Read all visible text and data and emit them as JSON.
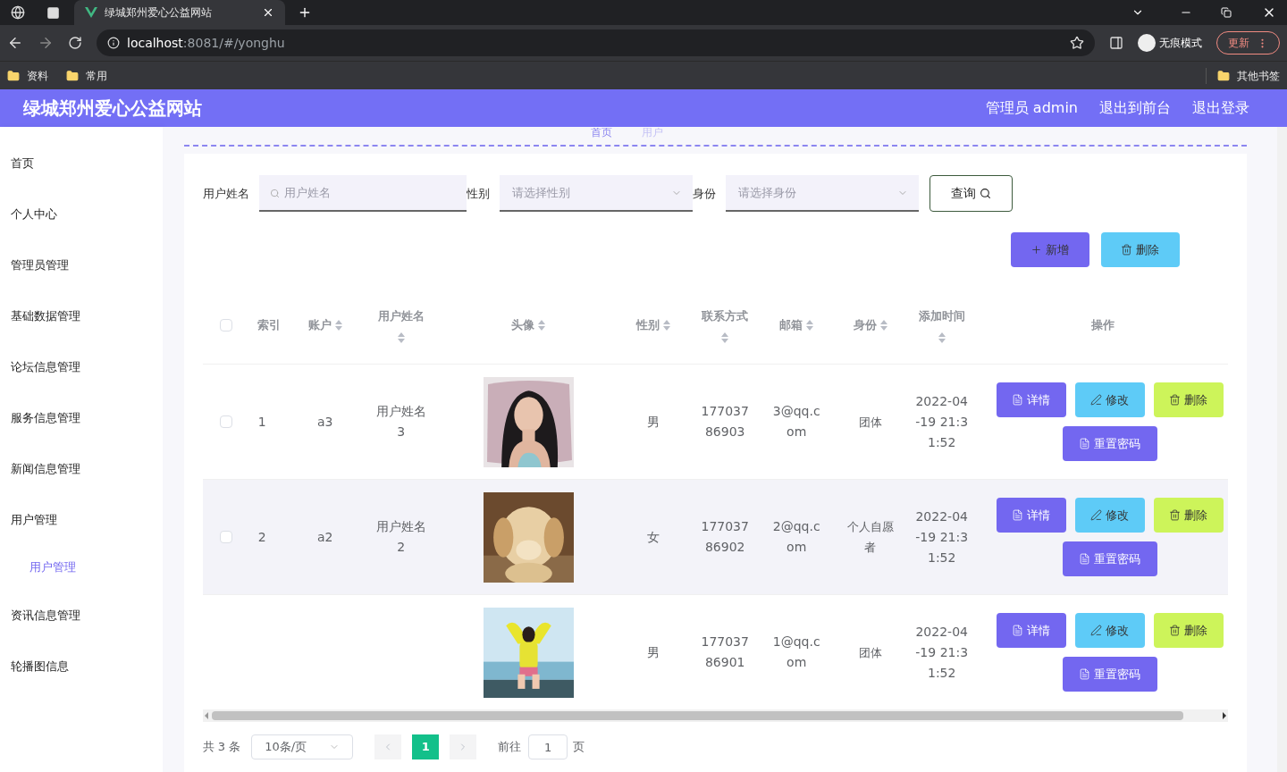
{
  "browser": {
    "tab_title": "绿城郑州爱心公益网站",
    "url_host": "localhost",
    "url_rest": ":8081/#/yonghu",
    "incognito_label": "无痕模式",
    "update_label": "更新",
    "bookmarks": [
      "资料",
      "常用"
    ],
    "other_bookmarks": "其他书签"
  },
  "header": {
    "title": "绿城郑州爱心公益网站",
    "links": [
      "管理员 admin",
      "退出到前台",
      "退出登录"
    ]
  },
  "sidebar": {
    "items": [
      {
        "label": "首页",
        "selected": false
      },
      {
        "label": "个人中心",
        "selected": false
      },
      {
        "label": "管理员管理",
        "selected": false
      },
      {
        "label": "基础数据管理",
        "selected": false
      },
      {
        "label": "论坛信息管理",
        "selected": false
      },
      {
        "label": "服务信息管理",
        "selected": false
      },
      {
        "label": "新闻信息管理",
        "selected": false
      },
      {
        "label": "用户管理",
        "selected": false,
        "children": [
          {
            "label": "用户管理",
            "selected": true
          }
        ]
      },
      {
        "label": "资讯信息管理",
        "selected": false
      },
      {
        "label": "轮播图信息",
        "selected": false
      }
    ]
  },
  "breadcrumb": [
    "首页",
    "用户"
  ],
  "search": {
    "fields": [
      {
        "kind": "text",
        "label": "用户姓名",
        "placeholder": "用户姓名"
      },
      {
        "kind": "select",
        "label": "性别",
        "placeholder": "请选择性别"
      },
      {
        "kind": "select",
        "label": "身份",
        "placeholder": "请选择身份"
      }
    ],
    "query_button": "查询"
  },
  "toolbar": [
    {
      "kind": "add",
      "label": "新增"
    },
    {
      "kind": "delete",
      "label": "删除"
    }
  ],
  "table": {
    "columns": [
      {
        "label": "索引",
        "sortable": false
      },
      {
        "label": "账户",
        "sortable": true
      },
      {
        "label": "用户姓名",
        "sortable": true
      },
      {
        "label": "头像",
        "sortable": true
      },
      {
        "label": "性别",
        "sortable": true
      },
      {
        "label": "联系方式",
        "sortable": true
      },
      {
        "label": "邮箱",
        "sortable": true
      },
      {
        "label": "身份",
        "sortable": true
      },
      {
        "label": "添加时间",
        "sortable": true
      },
      {
        "label": "操作",
        "sortable": false
      }
    ],
    "header_checked": false,
    "rows": [
      {
        "checked": false,
        "hovered": false,
        "index": "1",
        "account": "a3",
        "name": "用户姓名3",
        "gender": "男",
        "phone": "17703786903",
        "email": "3@qq.com",
        "role": "团体",
        "time": "2022-04-19 21:31:52",
        "actions": [
          {
            "kind": "detail",
            "label": "详情"
          },
          {
            "kind": "edit",
            "label": "修改"
          },
          {
            "kind": "delete",
            "label": "删除"
          },
          {
            "kind": "reset",
            "label": "重置密码"
          }
        ]
      },
      {
        "checked": false,
        "hovered": true,
        "index": "2",
        "account": "a2",
        "name": "用户姓名2",
        "gender": "女",
        "phone": "17703786902",
        "email": "2@qq.com",
        "role": "个人自愿者",
        "time": "2022-04-19 21:31:52",
        "actions": [
          {
            "kind": "detail",
            "label": "详情"
          },
          {
            "kind": "edit",
            "label": "修改"
          },
          {
            "kind": "delete",
            "label": "删除"
          },
          {
            "kind": "reset",
            "label": "重置密码"
          }
        ]
      },
      {
        "hovered": false,
        "gender": "男",
        "phone": "17703786901",
        "email": "1@qq.com",
        "role": "团体",
        "time": "2022-04-19 21:31:52",
        "actions": [
          {
            "kind": "detail",
            "label": "详情"
          },
          {
            "kind": "edit",
            "label": "修改"
          },
          {
            "kind": "delete",
            "label": "删除"
          },
          {
            "kind": "reset",
            "label": "重置密码"
          }
        ]
      }
    ]
  },
  "pagination": {
    "total": "共 3 条",
    "page_size": "10条/页",
    "pages": [
      {
        "label": "1",
        "selected": true
      }
    ],
    "goto_label": "前往",
    "goto_value": "1",
    "goto_suffix": "页"
  }
}
